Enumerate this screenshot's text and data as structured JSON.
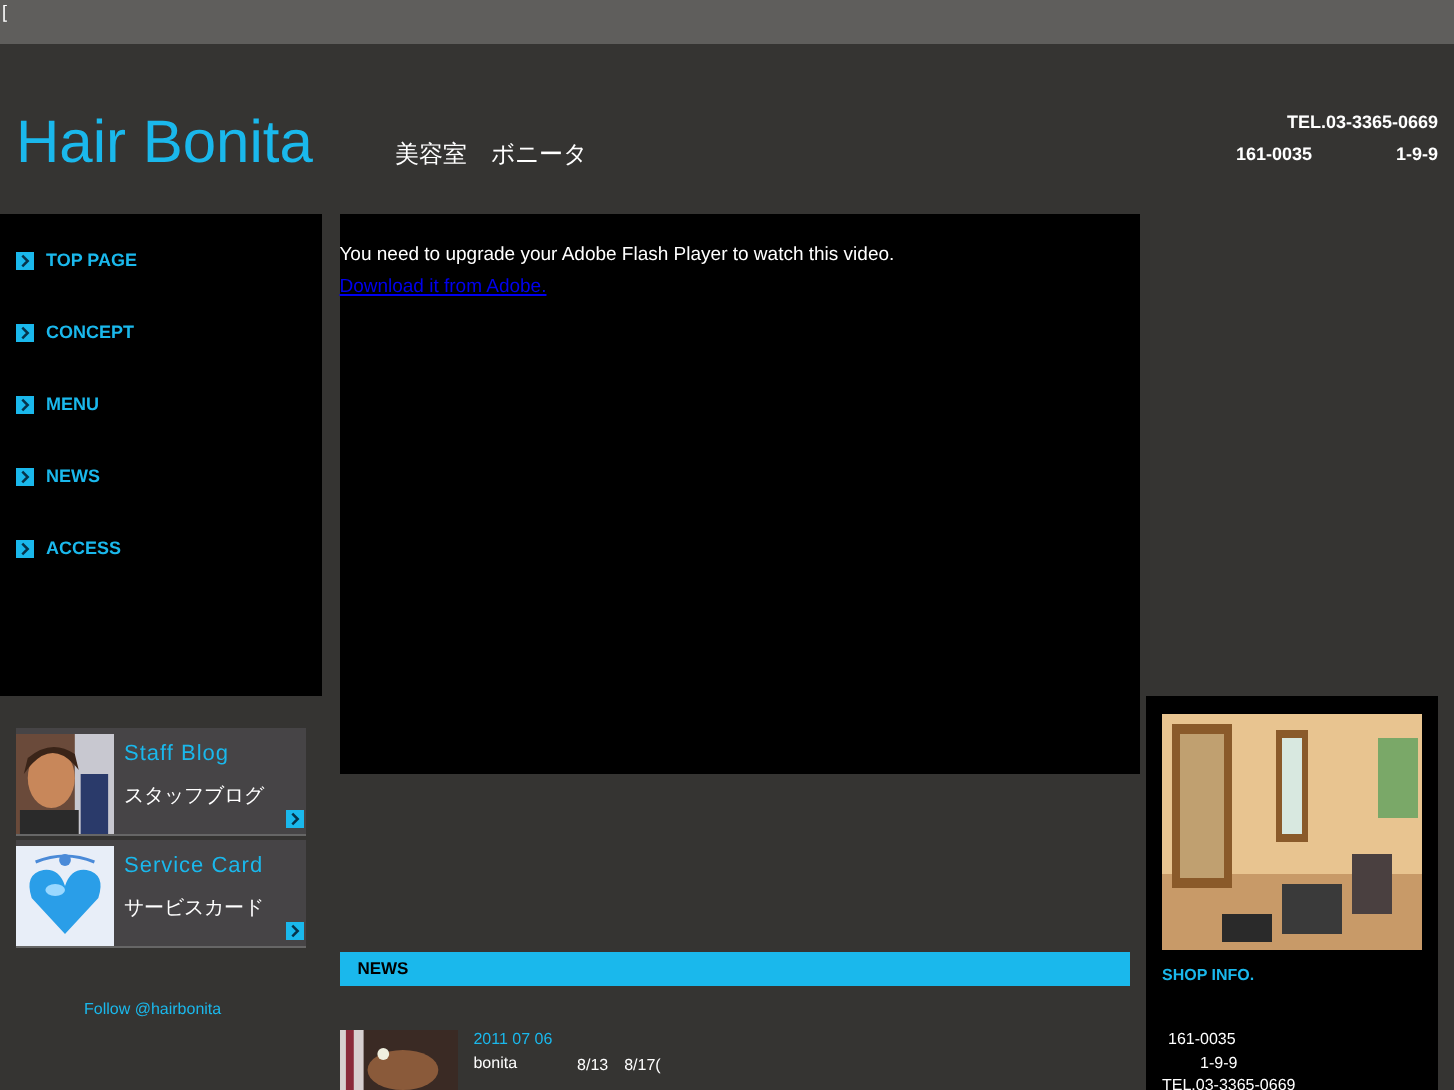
{
  "top_bar": {
    "text": "["
  },
  "header": {
    "logo": "Hair Bonita",
    "subtitle": "美容室　ボニータ",
    "tel": "TEL.03-3365-0669",
    "postal": "161-0035",
    "address": "1-9-9"
  },
  "nav": [
    {
      "label": "TOP PAGE"
    },
    {
      "label": "CONCEPT"
    },
    {
      "label": "MENU"
    },
    {
      "label": "NEWS"
    },
    {
      "label": "ACCESS"
    }
  ],
  "banners": [
    {
      "title": "Staff Blog",
      "subtitle": "スタッフブログ"
    },
    {
      "title": "Service Card",
      "subtitle": "サービスカード"
    }
  ],
  "follow": "Follow @hairbonita",
  "video": {
    "message": "You need to upgrade your Adobe Flash Player to watch this video.",
    "link": "Download it from Adobe."
  },
  "news": {
    "heading": "NEWS",
    "items": [
      {
        "date": "2011 07 06",
        "author": "bonita",
        "text": "8/13　8/17("
      }
    ]
  },
  "shop": {
    "heading": "SHOP INFO.",
    "postal": "161-0035",
    "address": "1-9-9",
    "tel": "TEL.03-3365-0669"
  }
}
